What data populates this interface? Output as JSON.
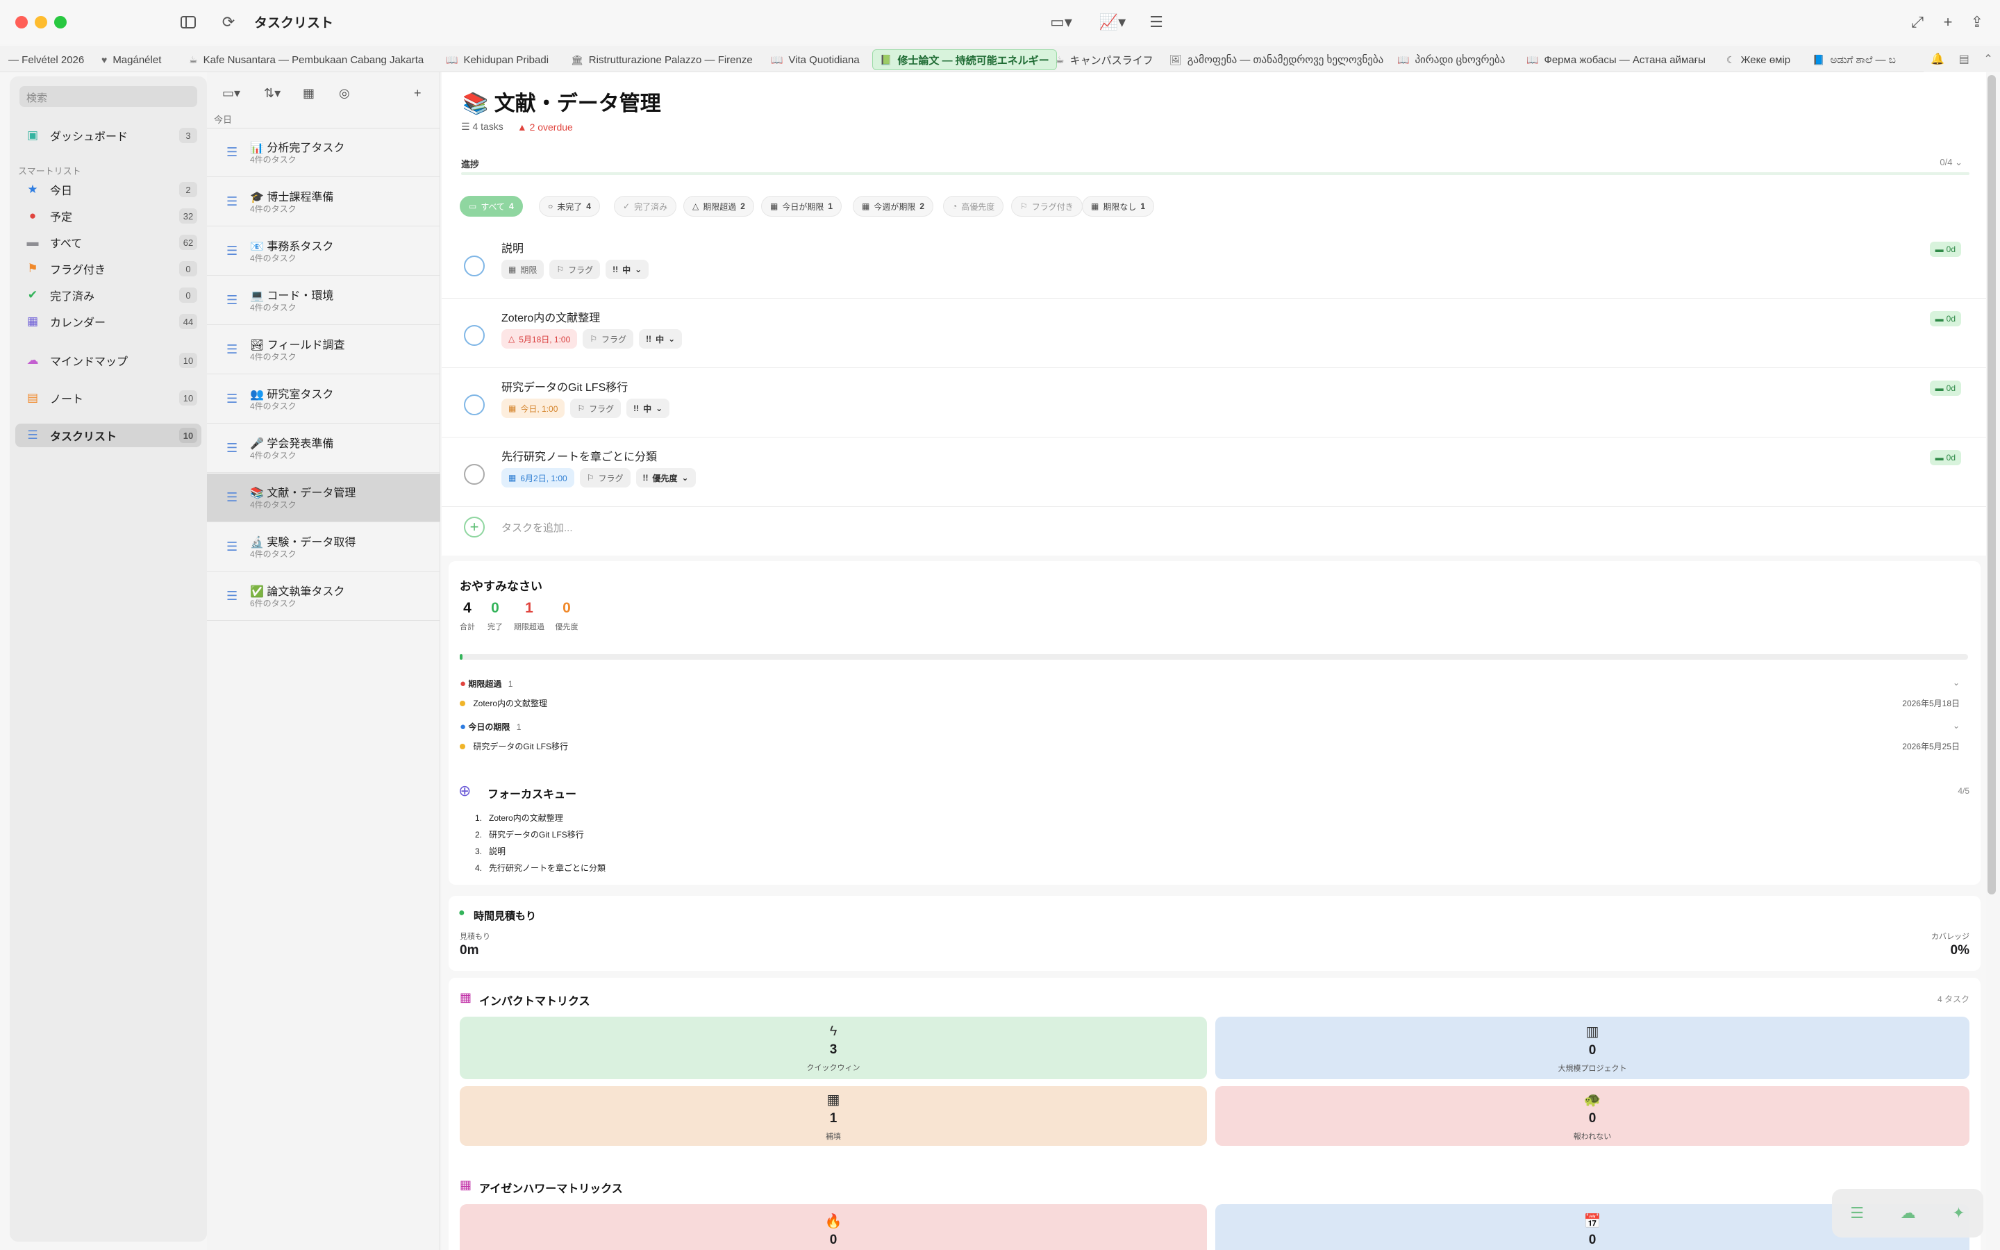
{
  "window": {
    "title": "タスクリスト"
  },
  "tabs": [
    {
      "label": "— Felvétel 2026",
      "icon": ""
    },
    {
      "label": "Magánélet",
      "icon": "♥"
    },
    {
      "label": "Kafe Nusantara — Pembukaan Cabang Jakarta",
      "icon": "☕"
    },
    {
      "label": "Kehidupan Pribadi",
      "icon": "📖"
    },
    {
      "label": "Ristrutturazione Palazzo — Firenze",
      "icon": "🏛"
    },
    {
      "label": "Vita Quotidiana",
      "icon": "📖"
    },
    {
      "label": "修士論文 — 持続可能エネルギー",
      "icon": "📗"
    },
    {
      "label": "キャンパスライフ",
      "icon": "☕"
    },
    {
      "label": "გამოფენა — თანამედროვე ხელოვნება",
      "icon": "🖼"
    },
    {
      "label": "პირადი ცხოვრება",
      "icon": "📖"
    },
    {
      "label": "Ферма жобасы — Астана аймағы",
      "icon": "📖"
    },
    {
      "label": "Жеке өмір",
      "icon": "☾"
    },
    {
      "label": "ಅಡುಗೆ ಶಾಲೆ — ಬ",
      "icon": "📘"
    }
  ],
  "sidebar": {
    "search_placeholder": "検索",
    "dashboard": {
      "label": "ダッシュボード",
      "count": "3"
    },
    "smart_section": "スマートリスト",
    "smart": [
      {
        "label": "今日",
        "count": "2",
        "icon": "★",
        "color": "#2f7de1"
      },
      {
        "label": "予定",
        "count": "32",
        "icon": "●",
        "color": "#e0443e"
      },
      {
        "label": "すべて",
        "count": "62",
        "icon": "▬",
        "color": "#8e8e93"
      },
      {
        "label": "フラグ付き",
        "count": "0",
        "icon": "⚑",
        "color": "#f0892a"
      },
      {
        "label": "完了済み",
        "count": "0",
        "icon": "✔",
        "color": "#34b35a"
      },
      {
        "label": "カレンダー",
        "count": "44",
        "icon": "▦",
        "color": "#6b5bd6"
      }
    ],
    "mindmap": {
      "label": "マインドマップ",
      "count": "10"
    },
    "notes": {
      "label": "ノート",
      "count": "10"
    },
    "tasklist": {
      "label": "タスクリスト",
      "count": "10"
    }
  },
  "list": {
    "date_label": "今日",
    "items": [
      {
        "emoji": "📊",
        "title": "分析完了タスク",
        "sub": "4件のタスク"
      },
      {
        "emoji": "🎓",
        "title": "博士課程準備",
        "sub": "4件のタスク"
      },
      {
        "emoji": "📧",
        "title": "事務系タスク",
        "sub": "4件のタスク"
      },
      {
        "emoji": "💻",
        "title": "コード・環境",
        "sub": "4件のタスク"
      },
      {
        "emoji": "🏞",
        "title": "フィールド調査",
        "sub": "4件のタスク"
      },
      {
        "emoji": "👥",
        "title": "研究室タスク",
        "sub": "4件のタスク"
      },
      {
        "emoji": "🎤",
        "title": "学会発表準備",
        "sub": "4件のタスク"
      },
      {
        "emoji": "📚",
        "title": "文献・データ管理",
        "sub": "4件のタスク"
      },
      {
        "emoji": "🔬",
        "title": "実験・データ取得",
        "sub": "4件のタスク"
      },
      {
        "emoji": "✅",
        "title": "論文執筆タスク",
        "sub": "6件のタスク"
      }
    ]
  },
  "main": {
    "title_emoji": "📚",
    "title": "文献・データ管理",
    "tasks_count": "4 tasks",
    "overdue": "2 overdue",
    "progress_label": "進捗",
    "progress_value": "0/4",
    "progress_fraction": 0,
    "filters": [
      {
        "label": "すべて",
        "count": "4"
      },
      {
        "label": "未完了",
        "count": "4"
      },
      {
        "label": "完了済み",
        "count": ""
      },
      {
        "label": "期限超過",
        "count": "2"
      },
      {
        "label": "今日が期限",
        "count": "1"
      },
      {
        "label": "今週が期限",
        "count": "2"
      },
      {
        "label": "高優先度",
        "count": ""
      },
      {
        "label": "フラグ付き",
        "count": ""
      },
      {
        "label": "期限なし",
        "count": "1"
      }
    ],
    "tasks": [
      {
        "title": "説明",
        "date": "期限",
        "flag": "フラグ",
        "priority": "中",
        "badge": "0d"
      },
      {
        "title": "Zotero内の文献整理",
        "date": "5月18日, 1:00",
        "flag": "フラグ",
        "priority": "中",
        "badge": "0d"
      },
      {
        "title": "研究データのGit LFS移行",
        "date": "今日, 1:00",
        "flag": "フラグ",
        "priority": "中",
        "badge": "0d"
      },
      {
        "title": "先行研究ノートを章ごとに分類",
        "date": "6月2日, 1:00",
        "flag": "フラグ",
        "priority": "優先度",
        "badge": "0d"
      }
    ],
    "add_task_placeholder": "タスクを追加..."
  },
  "summary": {
    "greeting": "おやすみなさい",
    "stats": [
      {
        "value": "4",
        "label": "合計",
        "color": "#111111"
      },
      {
        "value": "0",
        "label": "完了",
        "color": "#34b35a"
      },
      {
        "value": "1",
        "label": "期限超過",
        "color": "#e0443e"
      },
      {
        "value": "0",
        "label": "優先度",
        "color": "#f0892a"
      }
    ],
    "overdue_group": {
      "label": "期限超過",
      "count": "1",
      "task": "Zotero内の文献整理",
      "date": "2026年5月18日"
    },
    "today_group": {
      "label": "今日の期限",
      "count": "1",
      "task": "研究データのGit LFS移行",
      "date": "2026年5月25日"
    }
  },
  "focus": {
    "title": "フォーカスキュー",
    "count": "4/5",
    "items": [
      "Zotero内の文献整理",
      "研究データのGit LFS移行",
      "説明",
      "先行研究ノートを章ごとに分類"
    ]
  },
  "estimate": {
    "title": "時間見積もり",
    "left_label": "見積もり",
    "left_value": "0m",
    "right_label": "カバレッジ",
    "right_value": "0%"
  },
  "impact": {
    "title": "インパクトマトリクス",
    "count": "4 タスク",
    "quads": [
      {
        "value": "3",
        "label": "クイックウィン",
        "icon": "ϟ",
        "bg": "#daf1df"
      },
      {
        "value": "0",
        "label": "大規模プロジェクト",
        "icon": "▥",
        "bg": "#dae7f6"
      },
      {
        "value": "1",
        "label": "補填",
        "icon": "▦",
        "bg": "#f8e4d2"
      },
      {
        "value": "0",
        "label": "報われない",
        "icon": "🐢",
        "bg": "#f8dada"
      }
    ]
  },
  "eisenhower": {
    "title": "アイゼンハワーマトリックス",
    "quads": [
      {
        "value": "0",
        "icon": "🔥",
        "bg": "#f8dada"
      },
      {
        "value": "0",
        "icon": "📅",
        "bg": "#dae7f6"
      }
    ]
  }
}
